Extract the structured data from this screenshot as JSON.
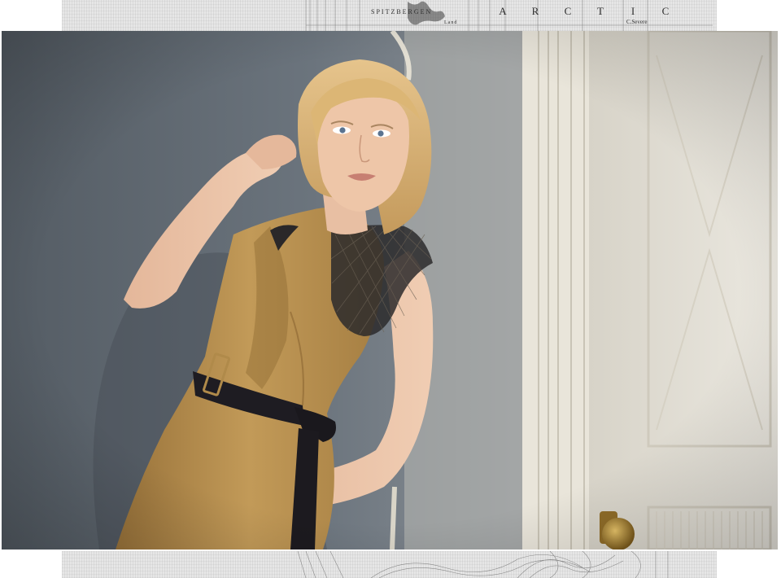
{
  "map_top": {
    "label_spitzbergen": "SPITZBERGEN",
    "label_land": "Land",
    "label_arctic": [
      "A",
      "R",
      "C",
      "T",
      "I",
      "C"
    ],
    "label_severe": "C.Severe"
  },
  "photo": {
    "subject": "woman-in-camel-dress",
    "dress_color": "#b48c4c",
    "belt_color": "#1e1c22",
    "hair_color": "#d9b57a",
    "wall_color": "#6d7680",
    "door_color": "#e6e2d8",
    "knob_color": "#b08a34"
  }
}
